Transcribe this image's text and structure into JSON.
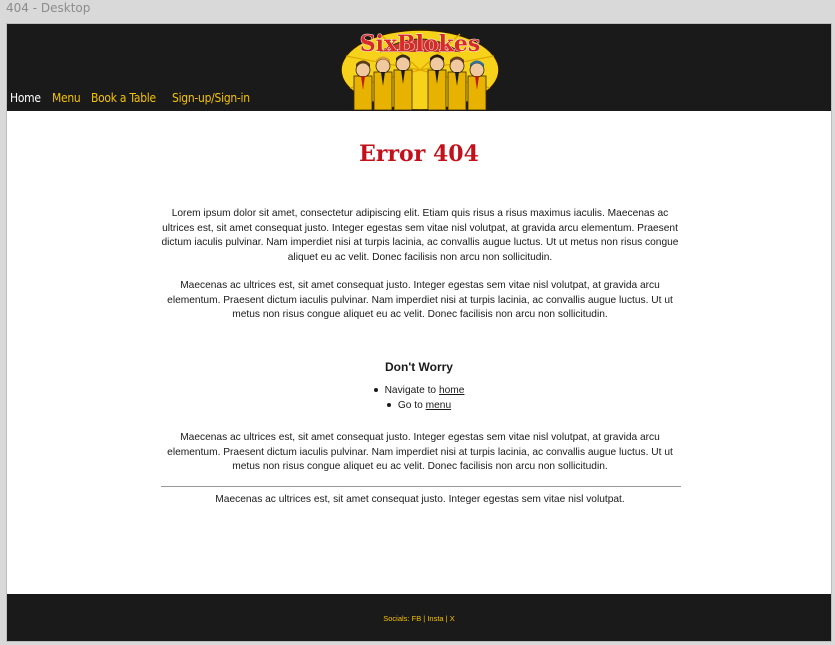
{
  "frame": {
    "label": "404 - Desktop"
  },
  "brand": {
    "name": "SixBlokes"
  },
  "colors": {
    "header_bg": "#1b1a1a",
    "accent": "#f3c200",
    "error_red": "#c3101a"
  },
  "nav": {
    "items": [
      {
        "label": "Home"
      },
      {
        "label": "Menu"
      },
      {
        "label": "Book a Table"
      },
      {
        "label": "Sign-up/Sign-in"
      }
    ]
  },
  "main": {
    "title": "Error 404",
    "paragraph1": "Lorem ipsum dolor sit amet, consectetur adipiscing elit. Etiam quis risus a risus maximus iaculis. Maecenas ac ultrices est, sit amet consequat justo. Integer egestas sem vitae nisl volutpat, at gravida arcu elementum. Praesent dictum iaculis pulvinar. Nam imperdiet nisi at turpis lacinia, ac convallis augue luctus. Ut ut metus non risus congue aliquet eu ac velit. Donec facilisis non arcu non sollicitudin.",
    "paragraph2": "Maecenas ac ultrices est, sit amet consequat justo. Integer egestas sem vitae nisl volutpat, at gravida arcu elementum. Praesent dictum iaculis pulvinar. Nam imperdiet nisi at turpis lacinia, ac convallis augue luctus. Ut ut metus non risus congue aliquet eu ac velit. Donec facilisis non arcu non sollicitudin.",
    "subheading": "Don't Worry",
    "links": [
      {
        "prefix": "Navigate to ",
        "link": "home"
      },
      {
        "prefix": "Go to ",
        "link": "menu"
      }
    ],
    "paragraph3": "Maecenas ac ultrices est, sit amet consequat justo. Integer egestas sem vitae nisl volutpat, at gravida arcu elementum. Praesent dictum iaculis pulvinar. Nam imperdiet nisi at turpis lacinia, ac convallis augue luctus. Ut ut metus non risus congue aliquet eu ac velit. Donec facilisis non arcu non sollicitudin.",
    "paragraph4": "Maecenas ac ultrices est, sit amet consequat justo. Integer egestas sem vitae nisl volutpat."
  },
  "footer": {
    "prefix": "Socials: ",
    "links": [
      "FB",
      "Insta",
      "X"
    ],
    "separator": " | "
  }
}
